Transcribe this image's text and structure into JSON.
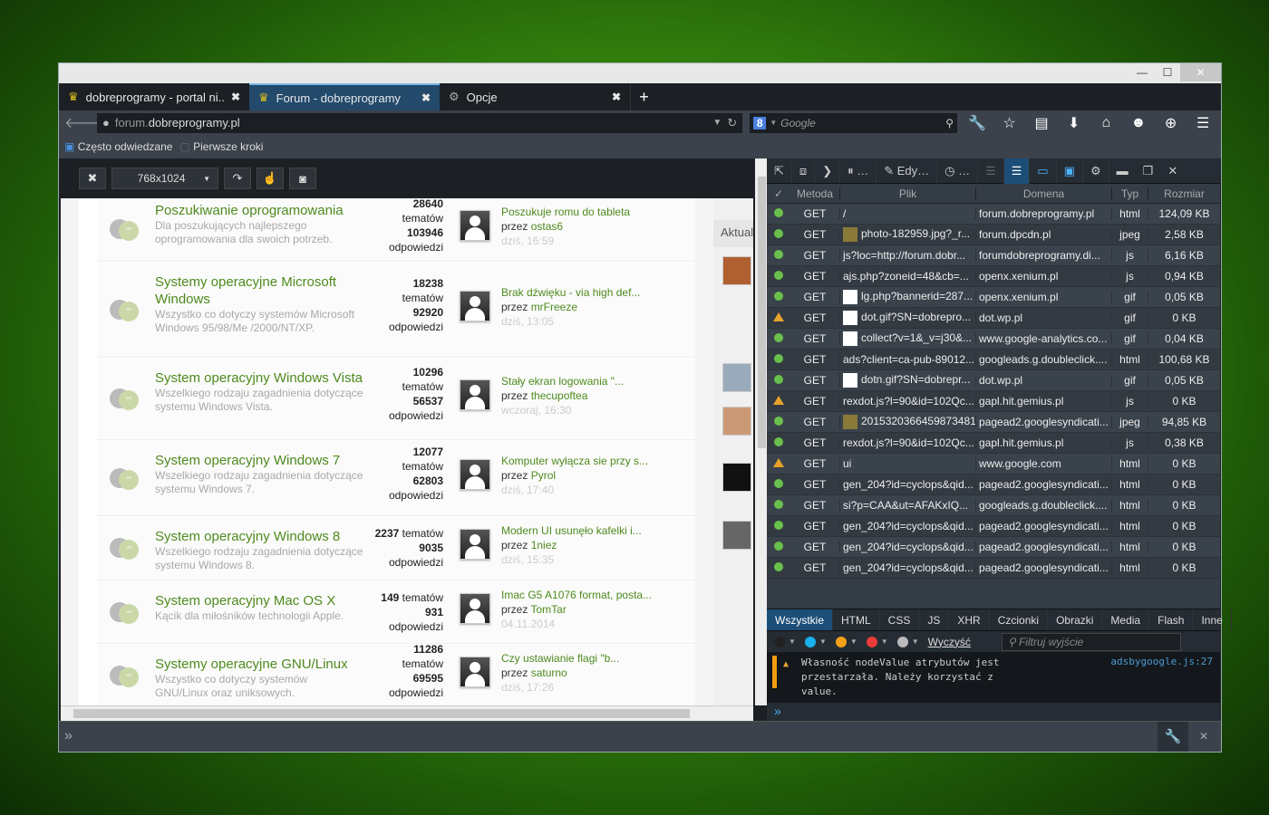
{
  "window": {
    "minimize": "—",
    "maximize": "☐",
    "close": "✕"
  },
  "tabs": [
    {
      "label": "dobreprogramy - portal ni...",
      "close": "✖"
    },
    {
      "label": "Forum - dobreprogramy",
      "close": "✖"
    },
    {
      "label": "Opcje",
      "close": "✖"
    }
  ],
  "new_tab": "+",
  "nav": {
    "url_prefix": "forum.",
    "url_domain": "dobreprogramy.pl",
    "search_placeholder": "Google",
    "search_engine": "8"
  },
  "bookmarks": [
    "Często odwiedzane",
    "Pierwsze kroki"
  ],
  "responsive": {
    "close": "✖",
    "size": "768x1024"
  },
  "forum": [
    {
      "title": "Poszukiwanie oprogramowania",
      "desc": "Dla poszukujących najlepszego oprogramowania dla swoich potrzeb.",
      "topics": "28640",
      "topics_label": "tematów",
      "replies": "103946",
      "replies_label": "odpowiedzi",
      "last": "Poszukuje romu do tableta",
      "by": "przez",
      "user": "ostas6",
      "date": "dziś, 16:59"
    },
    {
      "title": "Systemy operacyjne Microsoft Windows",
      "desc": "Wszystko co dotyczy systemów Microsoft Windows 95/98/Me /2000/NT/XP.",
      "topics": "18238",
      "topics_label": "tematów",
      "replies": "92920",
      "replies_label": "odpowiedzi",
      "last": "Brak dźwięku - via high def...",
      "by": "przez",
      "user": "mrFreeze",
      "date": "dziś, 13:05"
    },
    {
      "title": "System operacyjny Windows Vista",
      "desc": "Wszelkiego rodzaju zagadnienia dotyczące systemu Windows Vista.",
      "topics": "10296",
      "topics_label": "tematów",
      "replies": "56537",
      "replies_label": "odpowiedzi",
      "last": "Stały ekran logowania \"...",
      "by": "przez",
      "user": "thecupoftea",
      "date": "wczoraj, 16:30"
    },
    {
      "title": "System operacyjny Windows 7",
      "desc": "Wszelkiego rodzaju zagadnienia dotyczące systemu Windows 7.",
      "topics": "12077",
      "topics_label": "tematów",
      "replies": "62803",
      "replies_label": "odpowiedzi",
      "last": "Komputer wyłącza sie przy s...",
      "by": "przez",
      "user": "Pyrol",
      "date": "dziś, 17:40"
    },
    {
      "title": "System operacyjny Windows 8",
      "desc": "Wszelkiego rodzaju zagadnienia dotyczące systemu Windows 8.",
      "topics": "2237",
      "topics_label": "tematów",
      "replies": "9035",
      "replies_label": "odpowiedzi",
      "last": "Modern UI usunęło kafelki i...",
      "by": "przez",
      "user": "1niez",
      "date": "dziś, 15:35"
    },
    {
      "title": "System operacyjny Mac OS X",
      "desc": "Kącik dla miłośników technologii Apple.",
      "topics": "149",
      "topics_label": "tematów",
      "replies": "931",
      "replies_label": "odpowiedzi",
      "last": "Imac G5 A1076 format, posta...",
      "by": "przez",
      "user": "TomTar",
      "date": "04.11.2014"
    },
    {
      "title": "Systemy operacyjne GNU/Linux",
      "desc": "Wszystko co dotyczy systemów GNU/Linux oraz uniksowych.",
      "topics": "11286",
      "topics_label": "tematów",
      "replies": "69595",
      "replies_label": "odpowiedzi",
      "last": "Czy ustawianie flagi \"b...",
      "by": "przez",
      "user": "saturno",
      "date": "dziś, 17:26"
    }
  ],
  "sidebar_heading": "Aktualności",
  "devtools": {
    "tools": [
      "…",
      "Edy…",
      "…"
    ],
    "headers": [
      "✓",
      "Metoda",
      "Plik",
      "Domena",
      "Typ",
      "Rozmiar"
    ],
    "requests": [
      {
        "status": "ok",
        "method": "GET",
        "file": "/",
        "domain": "forum.dobreprogramy.pl",
        "type": "html",
        "size": "124,09 KB",
        "thumb": ""
      },
      {
        "status": "ok",
        "method": "GET",
        "file": "photo-182959.jpg?_r...",
        "domain": "forum.dpcdn.pl",
        "type": "jpeg",
        "size": "2,58 KB",
        "thumb": "img"
      },
      {
        "status": "ok",
        "method": "GET",
        "file": "js?loc=http://forum.dobr...",
        "domain": "forumdobreprogramy.di...",
        "type": "js",
        "size": "6,16 KB",
        "thumb": ""
      },
      {
        "status": "ok",
        "method": "GET",
        "file": "ajs.php?zoneid=48&cb=...",
        "domain": "openx.xenium.pl",
        "type": "js",
        "size": "0,94 KB",
        "thumb": ""
      },
      {
        "status": "ok",
        "method": "GET",
        "file": "lg.php?bannerid=287...",
        "domain": "openx.xenium.pl",
        "type": "gif",
        "size": "0,05 KB",
        "thumb": "blank"
      },
      {
        "status": "warn",
        "method": "GET",
        "file": "dot.gif?SN=dobrepro...",
        "domain": "dot.wp.pl",
        "type": "gif",
        "size": "0 KB",
        "thumb": "blank"
      },
      {
        "status": "ok",
        "method": "GET",
        "file": "collect?v=1&_v=j30&...",
        "domain": "www.google-analytics.co...",
        "type": "gif",
        "size": "0,04 KB",
        "thumb": "blank"
      },
      {
        "status": "ok",
        "method": "GET",
        "file": "ads?client=ca-pub-89012...",
        "domain": "googleads.g.doubleclick....",
        "type": "html",
        "size": "100,68 KB",
        "thumb": ""
      },
      {
        "status": "ok",
        "method": "GET",
        "file": "dotn.gif?SN=dobrepr...",
        "domain": "dot.wp.pl",
        "type": "gif",
        "size": "0,05 KB",
        "thumb": "blank"
      },
      {
        "status": "warn",
        "method": "GET",
        "file": "rexdot.js?l=90&id=102Qc...",
        "domain": "gapl.hit.gemius.pl",
        "type": "js",
        "size": "0 KB",
        "thumb": ""
      },
      {
        "status": "ok",
        "method": "GET",
        "file": "2015320366459873481",
        "domain": "pagead2.googlesyndicati...",
        "type": "jpeg",
        "size": "94,85 KB",
        "thumb": "img"
      },
      {
        "status": "ok",
        "method": "GET",
        "file": "rexdot.js?l=90&id=102Qc...",
        "domain": "gapl.hit.gemius.pl",
        "type": "js",
        "size": "0,38 KB",
        "thumb": ""
      },
      {
        "status": "warn",
        "method": "GET",
        "file": "ui",
        "domain": "www.google.com",
        "type": "html",
        "size": "0 KB",
        "thumb": ""
      },
      {
        "status": "ok",
        "method": "GET",
        "file": "gen_204?id=cyclops&qid...",
        "domain": "pagead2.googlesyndicati...",
        "type": "html",
        "size": "0 KB",
        "thumb": ""
      },
      {
        "status": "ok",
        "method": "GET",
        "file": "si?p=CAA&ut=AFAKxIQ...",
        "domain": "googleads.g.doubleclick....",
        "type": "html",
        "size": "0 KB",
        "thumb": ""
      },
      {
        "status": "ok",
        "method": "GET",
        "file": "gen_204?id=cyclops&qid...",
        "domain": "pagead2.googlesyndicati...",
        "type": "html",
        "size": "0 KB",
        "thumb": ""
      },
      {
        "status": "ok",
        "method": "GET",
        "file": "gen_204?id=cyclops&qid...",
        "domain": "pagead2.googlesyndicati...",
        "type": "html",
        "size": "0 KB",
        "thumb": ""
      },
      {
        "status": "ok",
        "method": "GET",
        "file": "gen_204?id=cyclops&qid...",
        "domain": "pagead2.googlesyndicati...",
        "type": "html",
        "size": "0 KB",
        "thumb": ""
      }
    ],
    "console_tabs": [
      "Wszystkie",
      "HTML",
      "CSS",
      "JS",
      "XHR",
      "Czcionki",
      "Obrazki",
      "Media",
      "Flash",
      "Inne"
    ],
    "filter_colors": [
      "#222222",
      "#1ab0f0",
      "#f5a21a",
      "#e83a3a",
      "#bbbbbb"
    ],
    "clear": "Wyczyść",
    "filter_placeholder": "Filtruj wyjście",
    "message": "Własność nodeValue atrybutów jest przestarzała. Należy korzystać z value.",
    "source": "adsbygoogle.js:27",
    "prompt": "»"
  },
  "bottom": {
    "prompt": "»",
    "close": "✕"
  }
}
